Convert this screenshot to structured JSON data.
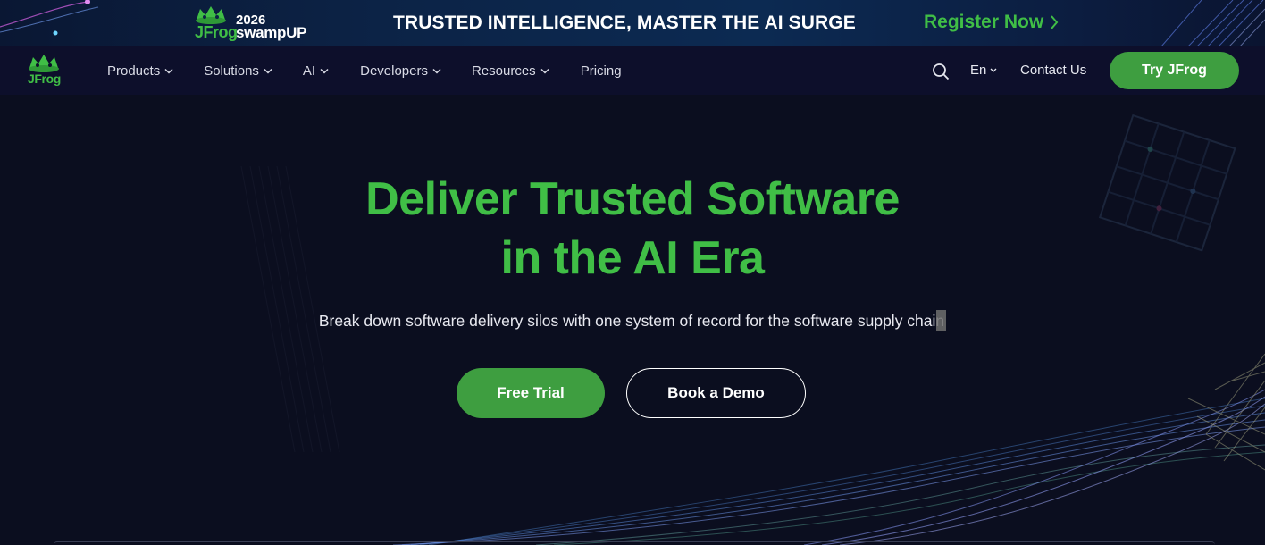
{
  "banner": {
    "logo_brand": "JFrog",
    "event_year": "2026",
    "event_name": "swampUP",
    "headline": "TRUSTED INTELLIGENCE, MASTER THE AI SURGE",
    "register_label": "Register Now"
  },
  "nav": {
    "logo_text": "JFrog",
    "items": [
      {
        "label": "Products",
        "has_dropdown": true
      },
      {
        "label": "Solutions",
        "has_dropdown": true
      },
      {
        "label": "AI",
        "has_dropdown": true
      },
      {
        "label": "Developers",
        "has_dropdown": true
      },
      {
        "label": "Resources",
        "has_dropdown": true
      },
      {
        "label": "Pricing",
        "has_dropdown": false
      }
    ],
    "language": "En",
    "contact_label": "Contact Us",
    "cta_label": "Try JFrog",
    "icons": {
      "search": "search-icon",
      "chevron": "chevron-down-icon"
    }
  },
  "hero": {
    "title_line1": "Deliver Trusted Software",
    "title_line2": "in the AI Era",
    "subtitle": "Break down software delivery silos with one system of record for the software supply chain",
    "primary_button": "Free Trial",
    "secondary_button": "Book a Demo"
  },
  "colors": {
    "brand_green": "#40be46",
    "button_green": "#3e9e40",
    "page_background": "#0b0e1f",
    "nav_background": "#0d0f2b"
  }
}
